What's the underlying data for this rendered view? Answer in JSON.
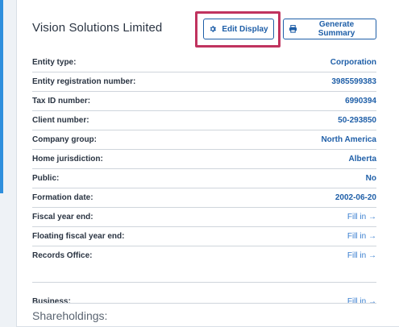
{
  "entity": {
    "name": "Vision Solutions Limited"
  },
  "buttons": {
    "edit_display": "Edit Display",
    "generate_summary": "Generate Summary"
  },
  "fields": [
    {
      "label": "Entity type:",
      "value": "Corporation"
    },
    {
      "label": "Entity registration number:",
      "value": "3985599383"
    },
    {
      "label": "Tax ID number:",
      "value": "6990394"
    },
    {
      "label": "Client number:",
      "value": "50-293850"
    },
    {
      "label": "Company group:",
      "value": "North America"
    },
    {
      "label": "Home jurisdiction:",
      "value": "Alberta"
    },
    {
      "label": "Public:",
      "value": "No"
    },
    {
      "label": "Formation date:",
      "value": "2002-06-20"
    },
    {
      "label": "Fiscal year end:",
      "value": "Fill in →"
    },
    {
      "label": "Floating fiscal year end:",
      "value": "Fill in →"
    },
    {
      "label": "Records Office:",
      "value": "Fill in →"
    },
    {
      "label": "Business:",
      "value": "Fill in →"
    }
  ],
  "sections": {
    "shareholdings": "Shareholdings:"
  },
  "colors": {
    "accent": "#1f5fa8",
    "highlight": "#c0335f",
    "left_bar": "#2f8fdd"
  },
  "icons": {
    "edit_display": "gear-icon",
    "generate_summary": "printer-icon"
  }
}
